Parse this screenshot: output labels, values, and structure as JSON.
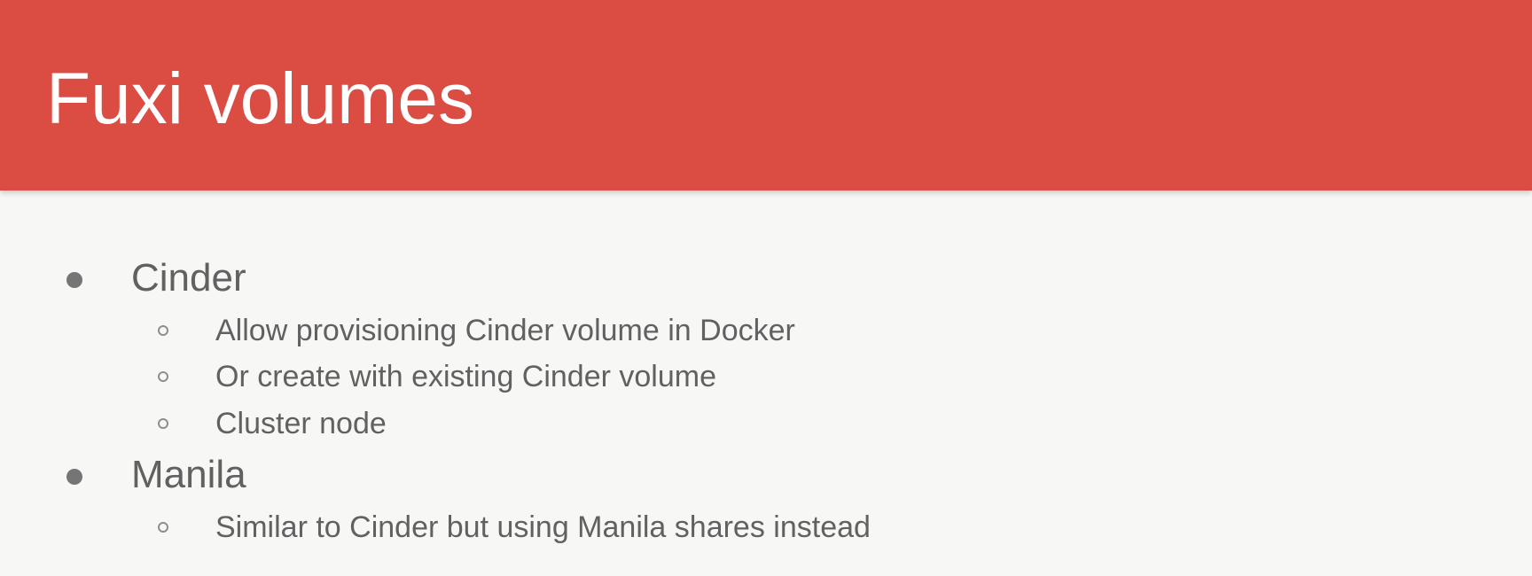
{
  "slide": {
    "title": "Fuxi volumes",
    "items": [
      {
        "label": "Cinder",
        "subitems": [
          "Allow provisioning Cinder volume in Docker",
          "Or create with existing Cinder volume",
          "Cluster node"
        ]
      },
      {
        "label": "Manila",
        "subitems": [
          "Similar to Cinder but using Manila shares instead"
        ]
      }
    ]
  },
  "colors": {
    "header": "#db4c42",
    "background": "#f7f8f6",
    "title_text": "#ffffff",
    "body_text": "#616161"
  },
  "icons": {
    "primary_bullet": "filled-circle-icon",
    "secondary_bullet": "hollow-circle-icon"
  }
}
